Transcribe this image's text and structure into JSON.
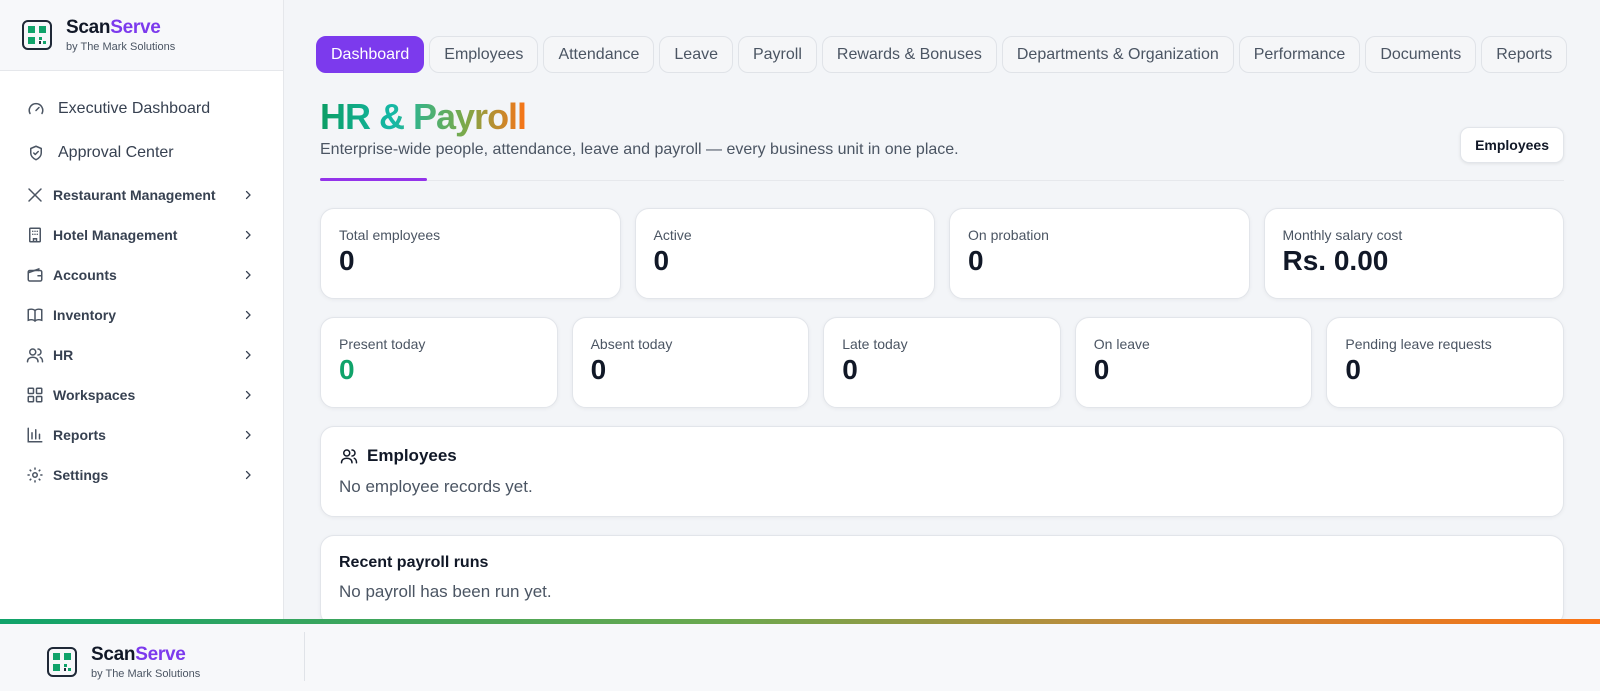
{
  "brand": {
    "name_prefix": "Scan",
    "name_accent": "Serve",
    "byline": "by The Mark Solutions"
  },
  "sidebar": {
    "top": [
      {
        "label": "Executive Dashboard",
        "icon": "gauge-icon"
      },
      {
        "label": "Approval Center",
        "icon": "shield-check-icon"
      }
    ],
    "items": [
      {
        "label": "Restaurant Management",
        "icon": "utensils-icon"
      },
      {
        "label": "Hotel Management",
        "icon": "building-icon"
      },
      {
        "label": "Accounts",
        "icon": "wallet-icon"
      },
      {
        "label": "Inventory",
        "icon": "book-icon"
      },
      {
        "label": "HR",
        "icon": "users-icon"
      },
      {
        "label": "Workspaces",
        "icon": "grid-icon"
      },
      {
        "label": "Reports",
        "icon": "bar-chart-icon"
      },
      {
        "label": "Settings",
        "icon": "gear-icon"
      }
    ]
  },
  "tabs": [
    {
      "label": "Dashboard",
      "active": true
    },
    {
      "label": "Employees"
    },
    {
      "label": "Attendance"
    },
    {
      "label": "Leave"
    },
    {
      "label": "Payroll"
    },
    {
      "label": "Rewards & Bonuses"
    },
    {
      "label": "Departments & Organization"
    },
    {
      "label": "Performance"
    },
    {
      "label": "Documents"
    },
    {
      "label": "Reports"
    }
  ],
  "header": {
    "title": "HR & Payroll",
    "subtitle": "Enterprise-wide people, attendance, leave and payroll — every business unit in one place.",
    "button_label": "Employees"
  },
  "stats_row1": [
    {
      "label": "Total employees",
      "value": "0"
    },
    {
      "label": "Active",
      "value": "0"
    },
    {
      "label": "On probation",
      "value": "0"
    },
    {
      "label": "Monthly salary cost",
      "value": "Rs. 0.00"
    }
  ],
  "stats_row2": [
    {
      "label": "Present today",
      "value": "0"
    },
    {
      "label": "Absent today",
      "value": "0"
    },
    {
      "label": "Late today",
      "value": "0"
    },
    {
      "label": "On leave",
      "value": "0"
    },
    {
      "label": "Pending leave requests",
      "value": "0"
    }
  ],
  "employees_panel": {
    "title": "Employees",
    "empty_text": "No employee records yet."
  },
  "payroll_panel": {
    "title": "Recent payroll runs",
    "empty_text": "No payroll has been run yet."
  },
  "colors": {
    "accent": "#7c3aed",
    "success": "#10a36a",
    "orange": "#f97316"
  }
}
